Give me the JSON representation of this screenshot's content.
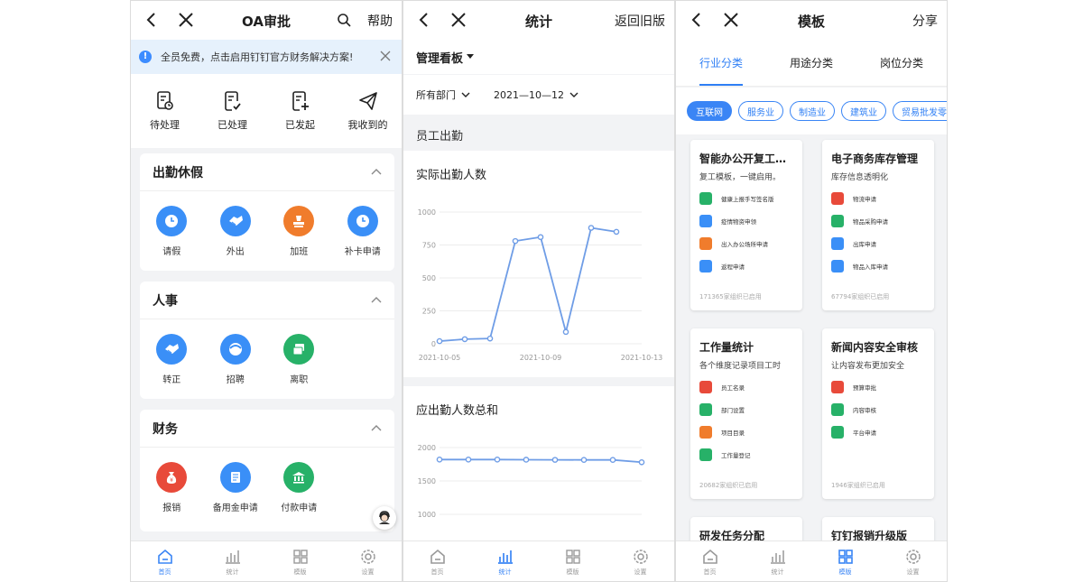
{
  "colors": {
    "accent": "#3a85f5",
    "blue": "#3a8ff7",
    "orange": "#f07c2c",
    "green": "#27b168",
    "red": "#e84a3a"
  },
  "panel1": {
    "title": "OA审批",
    "right": "帮助",
    "notice": "全员免费，点击启用钉钉官方财务解决方案!",
    "quick": [
      {
        "label": "待处理",
        "icon": "pending-doc-icon"
      },
      {
        "label": "已处理",
        "icon": "checked-doc-icon"
      },
      {
        "label": "已发起",
        "icon": "new-doc-icon"
      },
      {
        "label": "我收到的",
        "icon": "paper-plane-icon"
      }
    ],
    "sections": [
      {
        "title": "出勤休假",
        "apps": [
          {
            "label": "请假",
            "color": "#3a8ff7",
            "icon": "clock-icon"
          },
          {
            "label": "外出",
            "color": "#3a8ff7",
            "icon": "handshake-icon"
          },
          {
            "label": "加班",
            "color": "#f07c2c",
            "icon": "stamp-icon"
          },
          {
            "label": "补卡申请",
            "color": "#3a8ff7",
            "icon": "clock-icon"
          }
        ]
      },
      {
        "title": "人事",
        "apps": [
          {
            "label": "转正",
            "color": "#3a8ff7",
            "icon": "handshake-icon"
          },
          {
            "label": "招聘",
            "color": "#3a8ff7",
            "icon": "face-icon"
          },
          {
            "label": "离职",
            "color": "#27b168",
            "icon": "cards-icon"
          }
        ]
      },
      {
        "title": "财务",
        "apps": [
          {
            "label": "报销",
            "color": "#e84a3a",
            "icon": "money-bag-icon"
          },
          {
            "label": "备用金申请",
            "color": "#3a8ff7",
            "icon": "wallet-icon"
          },
          {
            "label": "付款申请",
            "color": "#27b168",
            "icon": "bank-icon"
          }
        ]
      }
    ]
  },
  "panel2": {
    "title": "统计",
    "right": "返回旧版",
    "board": "管理看板",
    "dept": "所有部门",
    "date": "2021—10—12",
    "section": "员工出勤",
    "chart1_title": "实际出勤人数",
    "chart2_title": "应出勤人数总和"
  },
  "chart_data": [
    {
      "type": "line",
      "title": "实际出勤人数",
      "x": [
        "2021-10-05",
        "2021-10-06",
        "2021-10-07",
        "2021-10-08",
        "2021-10-09",
        "2021-10-10",
        "2021-10-11",
        "2021-10-12",
        "2021-10-13"
      ],
      "xtick_labels": [
        "2021-10-05",
        "2021-10-09",
        "2021-10-13"
      ],
      "series": [
        {
          "values": [
            20,
            35,
            40,
            780,
            810,
            90,
            880,
            850
          ]
        }
      ],
      "yticks": [
        0,
        250,
        500,
        750,
        1000
      ],
      "ylim": [
        0,
        1000
      ],
      "grid": true,
      "color": "#6f9de6"
    },
    {
      "type": "line",
      "title": "应出勤人数总和",
      "series": [
        {
          "values": [
            1820,
            1820,
            1820,
            1818,
            1816,
            1815,
            1815,
            1780
          ]
        }
      ],
      "yticks": [
        1000,
        1500,
        2000
      ],
      "ylim": [
        1000,
        2000
      ],
      "grid": true,
      "color": "#6f9de6"
    }
  ],
  "panel3": {
    "title": "模板",
    "right": "分享",
    "tabs": [
      "行业分类",
      "用途分类",
      "岗位分类"
    ],
    "chips": [
      "互联网",
      "服务业",
      "制造业",
      "建筑业",
      "贸易批发零售"
    ],
    "cards": [
      {
        "title": "智能办公开复工…",
        "desc": "复工模板，一键启用。",
        "items": [
          {
            "label": "健康上报手写签名版",
            "color": "#27b168"
          },
          {
            "label": "疫情物资申领",
            "color": "#3a8ff7"
          },
          {
            "label": "出入办公场所申请",
            "color": "#f07c2c"
          },
          {
            "label": "返程申请",
            "color": "#3a8ff7"
          }
        ],
        "footer": "171365家组织已启用"
      },
      {
        "title": "电子商务库存管理",
        "desc": "库存信息透明化",
        "items": [
          {
            "label": "物流申请",
            "color": "#e84a3a"
          },
          {
            "label": "物品采购申请",
            "color": "#27b168"
          },
          {
            "label": "出库申请",
            "color": "#3a8ff7"
          },
          {
            "label": "物品入库申请",
            "color": "#3a8ff7"
          }
        ],
        "footer": "67794家组织已启用"
      },
      {
        "title": "工作量统计",
        "desc": "各个维度记录项目工时",
        "items": [
          {
            "label": "员工名录",
            "color": "#e84a3a"
          },
          {
            "label": "部门设置",
            "color": "#27b168"
          },
          {
            "label": "项目目录",
            "color": "#f07c2c"
          },
          {
            "label": "工作量登记",
            "color": "#27b168"
          }
        ],
        "footer": "20682家组织已启用"
      },
      {
        "title": "新闻内容安全审核",
        "desc": "让内容发布更加安全",
        "items": [
          {
            "label": "预算审批",
            "color": "#e84a3a"
          },
          {
            "label": "内容审核",
            "color": "#27b168"
          },
          {
            "label": "平台申请",
            "color": "#27b168"
          }
        ],
        "footer": "1946家组织已启用"
      },
      {
        "title": "研发任务分配"
      },
      {
        "title": "钉钉报销升级版"
      }
    ]
  },
  "tabbar": [
    "首页",
    "统计",
    "模版",
    "设置"
  ]
}
